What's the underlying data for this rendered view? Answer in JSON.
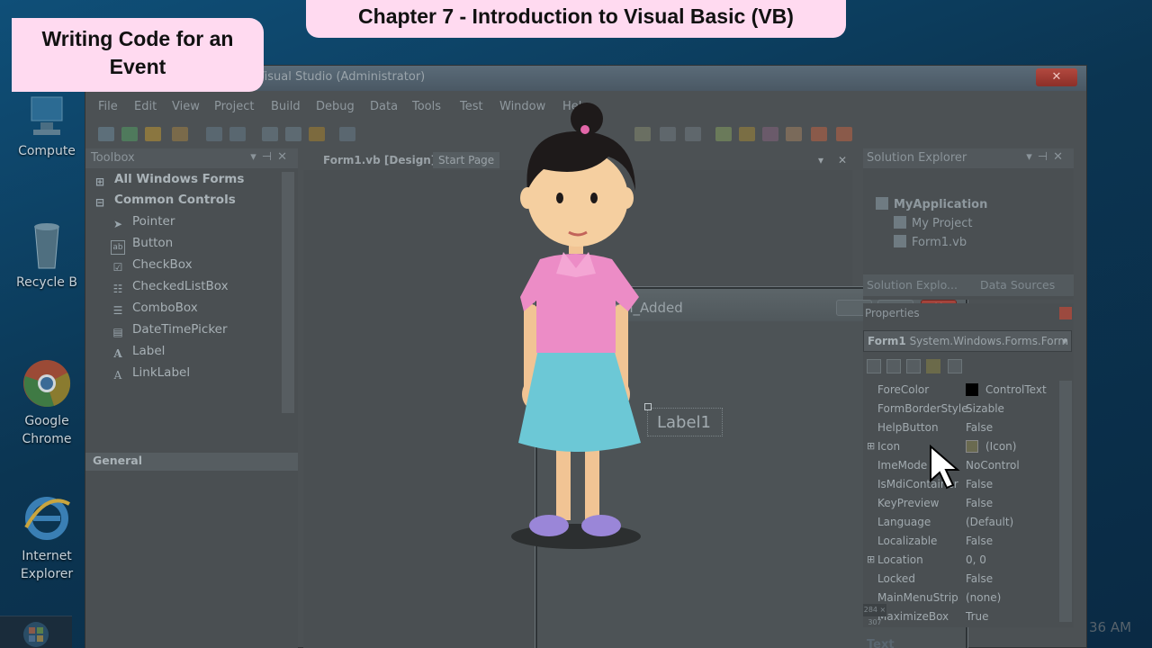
{
  "desktop": {
    "icons": [
      {
        "label": "Compute",
        "icon": "computer-icon"
      },
      {
        "label": "Recycle B",
        "icon": "recycle-bin-icon"
      },
      {
        "label": "Google Chrome",
        "icon": "chrome-icon"
      },
      {
        "label": "Internet Explorer",
        "icon": "internet-explorer-icon"
      }
    ],
    "clock": "36 AM"
  },
  "vs": {
    "title": "Visual Studio (Administrator)",
    "menu": [
      "File",
      "Edit",
      "View",
      "Project",
      "Build",
      "Debug",
      "Data",
      "Tools",
      "Test",
      "Window",
      "Help"
    ],
    "toolbox": {
      "title": "Toolbox",
      "groups": [
        {
          "label": "All Windows Forms"
        },
        {
          "label": "Common Controls"
        }
      ],
      "items": [
        {
          "label": "Pointer",
          "icon": "pointer-icon"
        },
        {
          "label": "Button",
          "icon": "button-icon"
        },
        {
          "label": "CheckBox",
          "icon": "checkbox-icon"
        },
        {
          "label": "CheckedListBox",
          "icon": "checkedlistbox-icon"
        },
        {
          "label": "ComboBox",
          "icon": "combobox-icon"
        },
        {
          "label": "DateTimePicker",
          "icon": "datetimepicker-icon"
        },
        {
          "label": "Label",
          "icon": "label-icon"
        },
        {
          "label": "LinkLabel",
          "icon": "linklabel-icon"
        }
      ],
      "general": "General"
    },
    "tabs": {
      "design": "Form1.vb [Design]",
      "start": "Start Page"
    },
    "form": {
      "title": "NewForm_Added",
      "label": "Label1"
    },
    "solution_explorer": {
      "title": "Solution Explorer",
      "items": [
        "MyApplication",
        "My Project",
        "Form1.vb"
      ],
      "tabs": [
        "Solution Explo...",
        "Data Sources"
      ]
    },
    "properties": {
      "title": "Properties",
      "object_name": "Form1",
      "object_type": "System.Windows.Forms.Form",
      "rows": [
        {
          "name": "ForeColor",
          "value": "ControlText",
          "swatch": "#000000"
        },
        {
          "name": "FormBorderStyle",
          "value": "Sizable"
        },
        {
          "name": "HelpButton",
          "value": "False"
        },
        {
          "name": "Icon",
          "value": "(Icon)",
          "expandable": true
        },
        {
          "name": "ImeMode",
          "value": "NoControl"
        },
        {
          "name": "IsMdiContainer",
          "value": "False"
        },
        {
          "name": "KeyPreview",
          "value": "False"
        },
        {
          "name": "Language",
          "value": "(Default)"
        },
        {
          "name": "Localizable",
          "value": "False"
        },
        {
          "name": "Location",
          "value": "0, 0",
          "expandable": true
        },
        {
          "name": "Locked",
          "value": "False"
        },
        {
          "name": "MainMenuStrip",
          "value": "(none)"
        },
        {
          "name": "MaximizeBox",
          "value": "True"
        }
      ],
      "footer": "Text",
      "size_indicator": "284 × 307"
    }
  },
  "overlay": {
    "chapter": "Chapter 7 - Introduction to Visual Basic (VB)",
    "topic": "Writing Code for an Event"
  },
  "colors": {
    "banner_bg": "#ffdaf0",
    "shirt": "#ec8cc6",
    "skirt": "#6cc8d6",
    "shoes": "#9a86d8"
  }
}
